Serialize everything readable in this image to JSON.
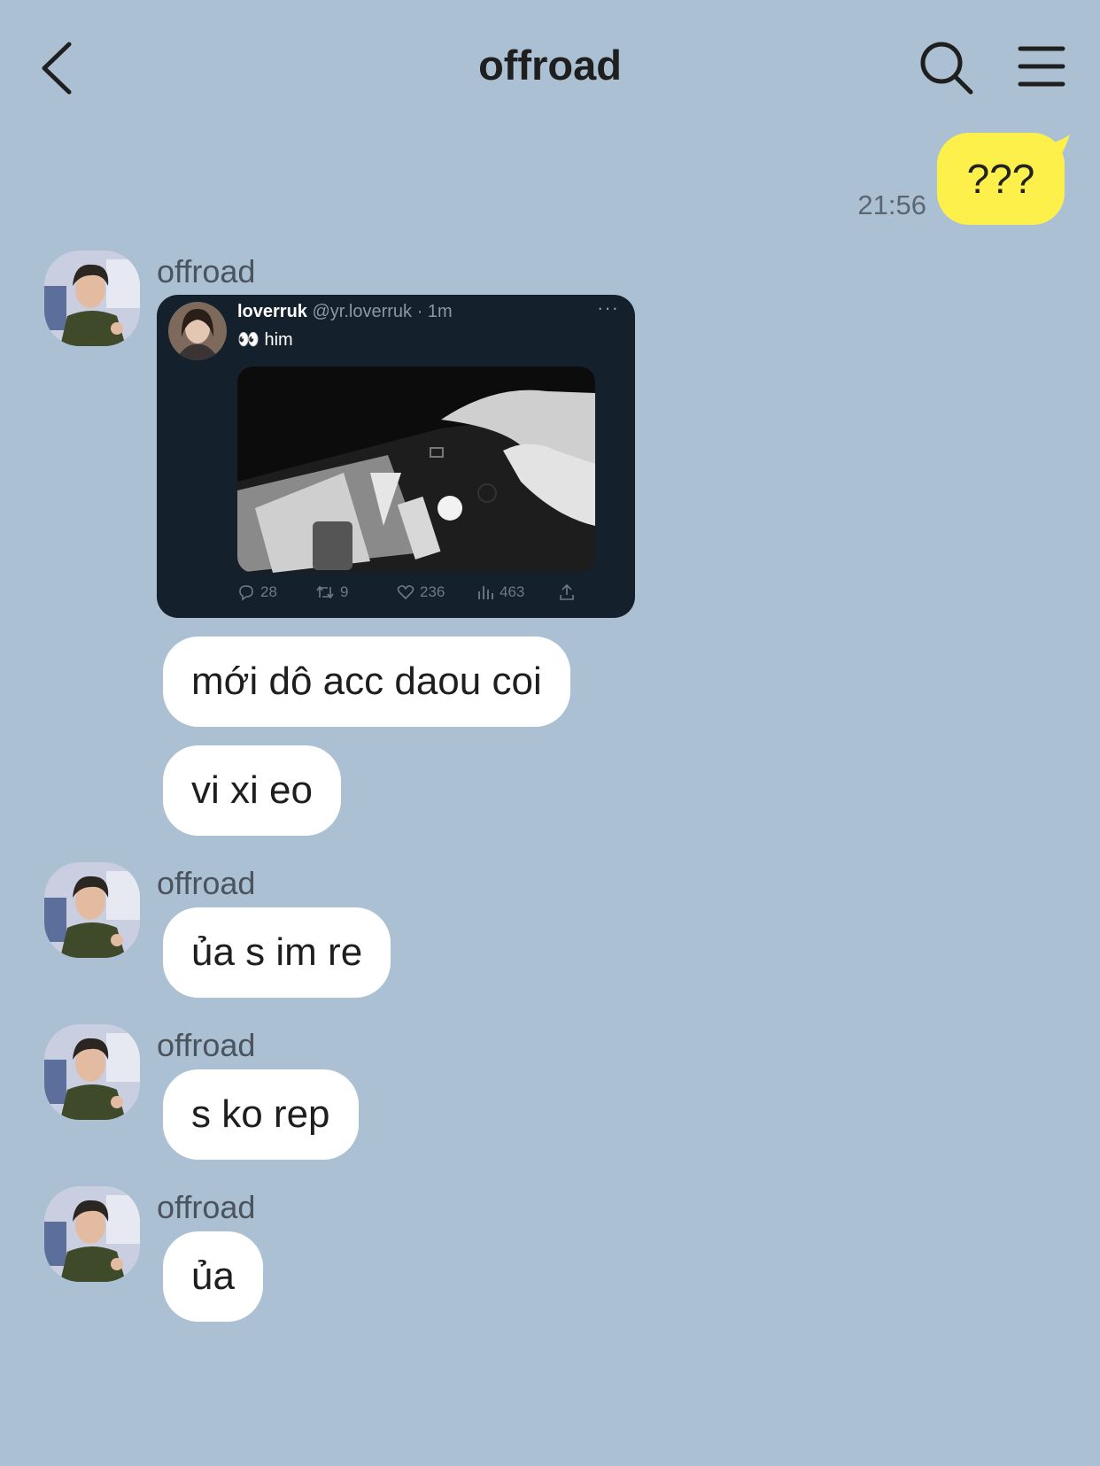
{
  "header": {
    "title": "offroad",
    "back_icon": "chevron-left-icon",
    "search_icon": "search-icon",
    "menu_icon": "hamburger-menu-icon"
  },
  "colors": {
    "background": "#abc1d3",
    "my_bubble": "#fef04a",
    "their_bubble": "#ffffff",
    "tweet_card": "#14202b"
  },
  "my_message": {
    "text": "???",
    "time": "21:56"
  },
  "tweet": {
    "name": "loverruk",
    "handle": "@yr.loverruk",
    "age": "· 1m",
    "text": "👀 him",
    "more": "···",
    "replies": "28",
    "retweets": "9",
    "likes": "236",
    "views": "463"
  },
  "messages": [
    {
      "sender": "offroad",
      "text": "mới dô acc daou coi"
    },
    {
      "sender": "offroad",
      "text": "vi xi eo"
    },
    {
      "sender": "offroad",
      "text": "ủa s im re"
    },
    {
      "sender": "offroad",
      "text": "s ko rep"
    },
    {
      "sender": "offroad",
      "text": "ủa"
    }
  ],
  "sender_labels": [
    "offroad",
    "offroad",
    "offroad",
    "offroad"
  ]
}
